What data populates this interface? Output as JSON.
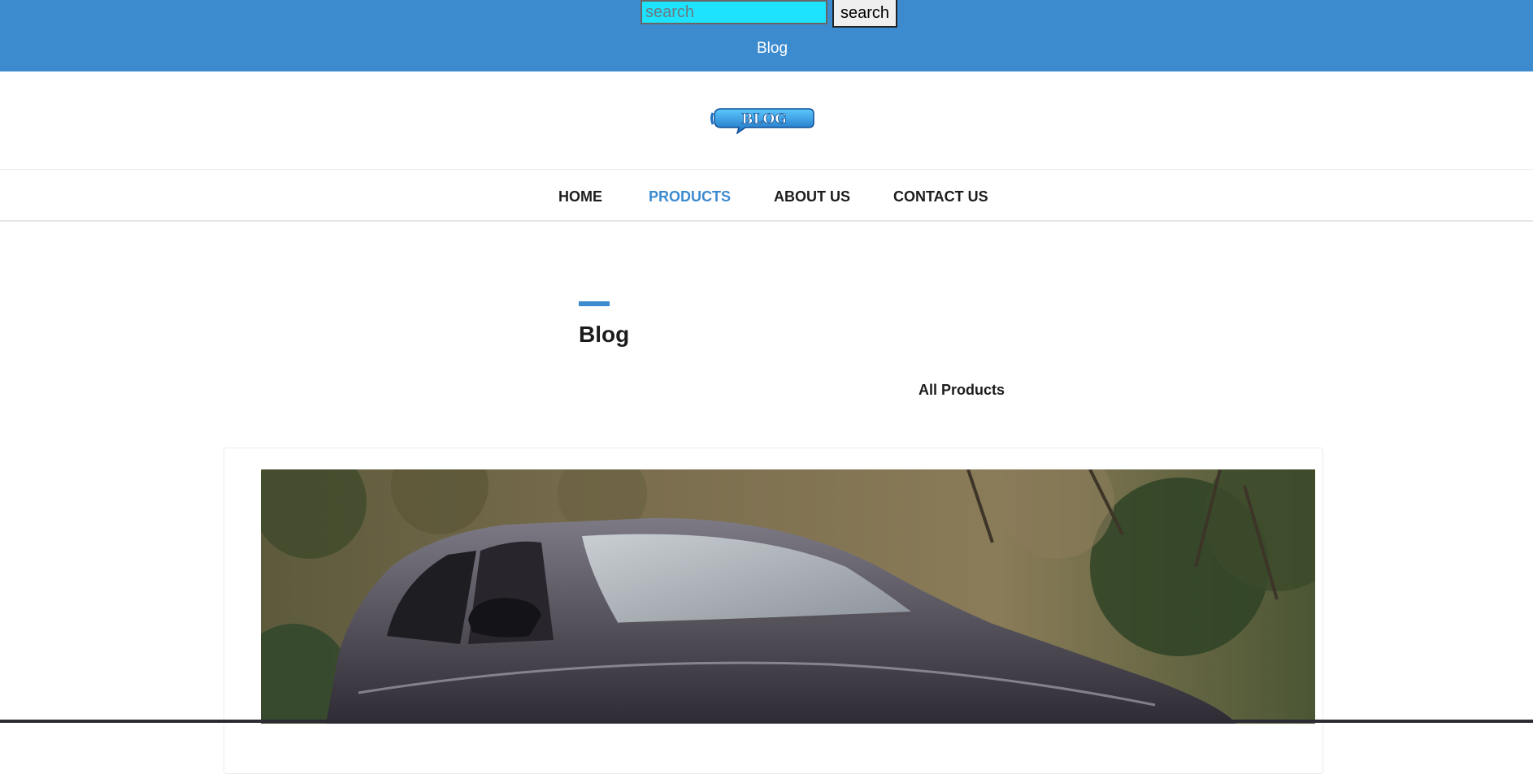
{
  "topbar": {
    "search_placeholder": "search",
    "search_value": "",
    "search_button": "search",
    "title": "Blog",
    "bg_color": "#3c8bcf"
  },
  "logo": {
    "alt": "BLOG"
  },
  "nav": {
    "items": [
      {
        "label": "HOME",
        "active": false
      },
      {
        "label": "PRODUCTS",
        "active": true
      },
      {
        "label": "ABOUT US",
        "active": false
      },
      {
        "label": "CONTACT US",
        "active": false
      }
    ],
    "active_color": "#3c8bcf"
  },
  "section": {
    "title": "Blog",
    "filter_link": "All Products"
  },
  "card": {
    "image_subject": "dark grey hatchback car in front of trees"
  }
}
